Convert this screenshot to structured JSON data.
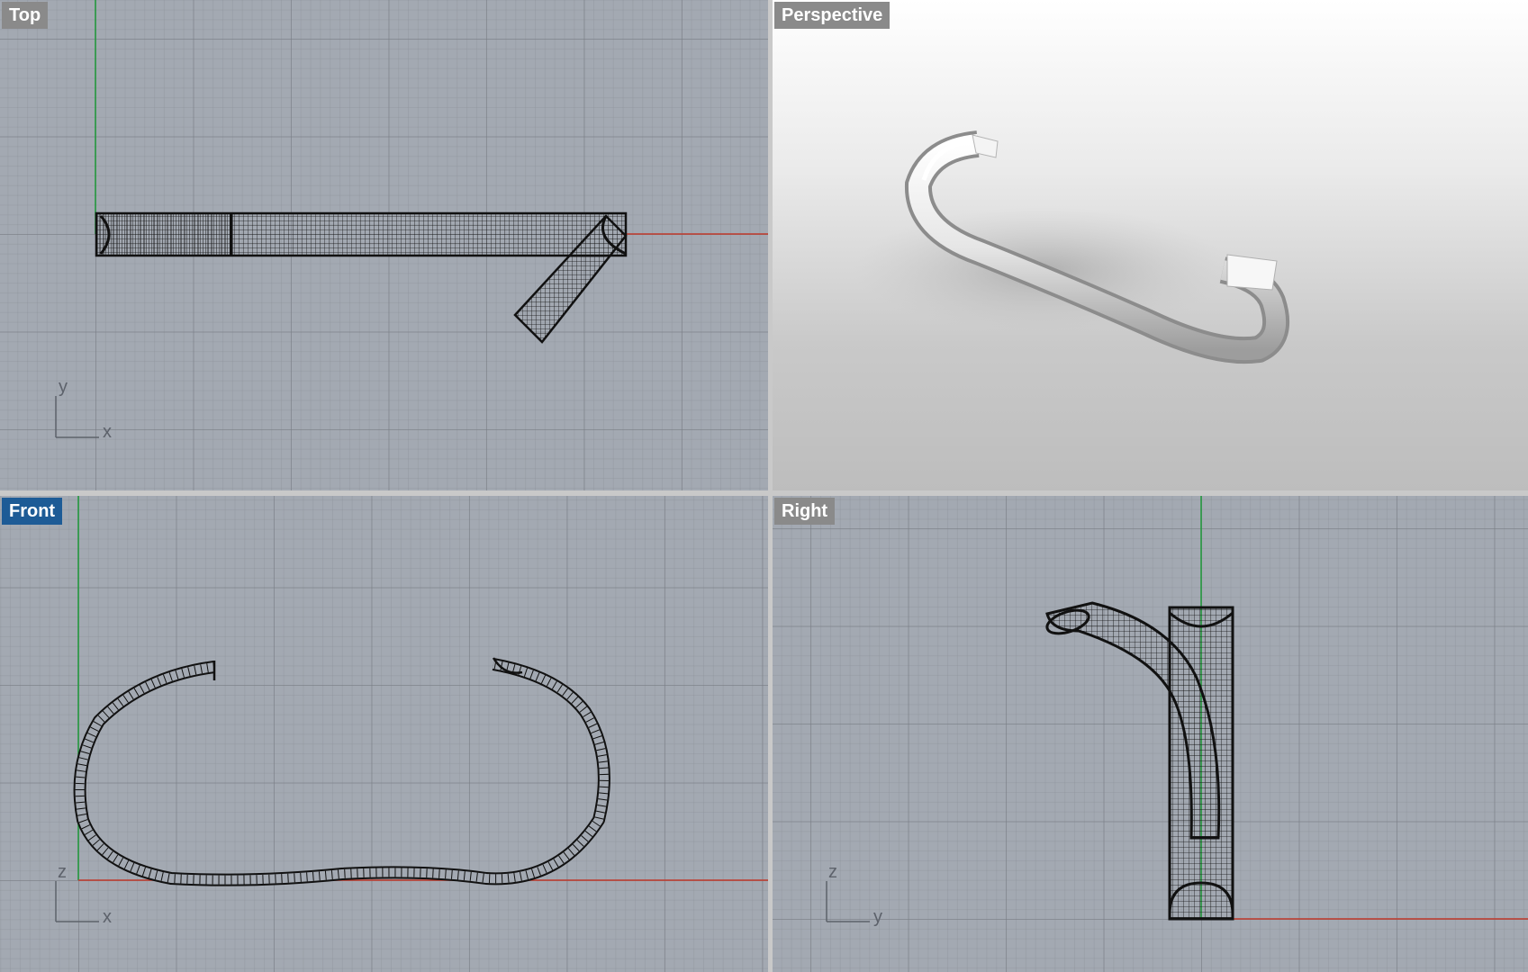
{
  "viewports": {
    "top": {
      "label": "Top",
      "axis_h": "x",
      "axis_v": "y",
      "active": false
    },
    "persp": {
      "label": "Perspective",
      "active": false
    },
    "front": {
      "label": "Front",
      "axis_h": "x",
      "axis_v": "z",
      "active": true
    },
    "right": {
      "label": "Right",
      "axis_h": "y",
      "axis_v": "z",
      "active": false
    }
  },
  "colors": {
    "grid_bg": "#a3a9b2",
    "x_axis": "#c0392b",
    "y_axis": "#1f9a3a",
    "wire": "#111111",
    "active_label": "#1d5b96",
    "inactive_label": "#8a8a8a"
  }
}
